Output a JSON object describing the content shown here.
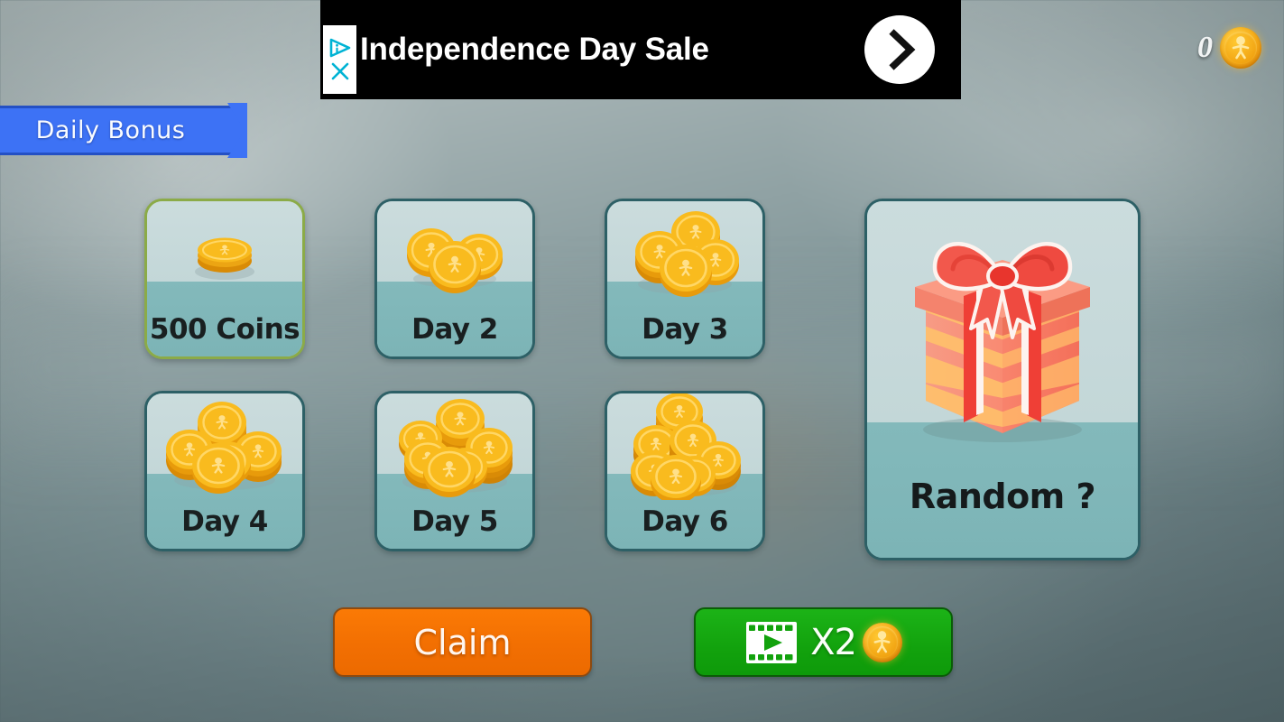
{
  "ad": {
    "title": "Independence Day Sale",
    "adchoices_icon": "adchoices-triangle-icon",
    "close_icon": "close-x-icon",
    "cta_icon": "chevron-right-icon"
  },
  "hud": {
    "coin_count": "0",
    "coin_icon": "coin-icon"
  },
  "header": {
    "ribbon_label": "Daily Bonus"
  },
  "days": [
    {
      "label": "500 Coins",
      "coins": 1,
      "selected": true,
      "art": "coin-stack-icon"
    },
    {
      "label": "Day 2",
      "coins": 3,
      "selected": false,
      "art": "coin-stack-icon"
    },
    {
      "label": "Day 3",
      "coins": 5,
      "selected": false,
      "art": "coin-stack-icon"
    },
    {
      "label": "Day 4",
      "coins": 7,
      "selected": false,
      "art": "coin-stack-icon"
    },
    {
      "label": "Day 5",
      "coins": 9,
      "selected": false,
      "art": "coin-stack-icon"
    },
    {
      "label": "Day 6",
      "coins": 12,
      "selected": false,
      "art": "coin-stack-icon"
    }
  ],
  "random": {
    "label": "Random ?",
    "art": "gift-box-icon"
  },
  "buttons": {
    "claim_label": "Claim",
    "x2_label": "X2",
    "video_icon": "video-filmstrip-icon",
    "x2_coin_icon": "coin-icon"
  },
  "colors": {
    "ribbon_blue": "#3d72f5",
    "ribbon_border": "#2450c4",
    "card_top": "#c6d9da",
    "card_bottom": "#7cb6b8",
    "card_border": "#2d6066",
    "card_border_selected": "#8bab48",
    "claim_orange": "#f26f02",
    "x2_green": "#12a20d",
    "coin_gold": "#f2a513",
    "gift_red": "#ef5350",
    "ad_bg": "#000000"
  }
}
